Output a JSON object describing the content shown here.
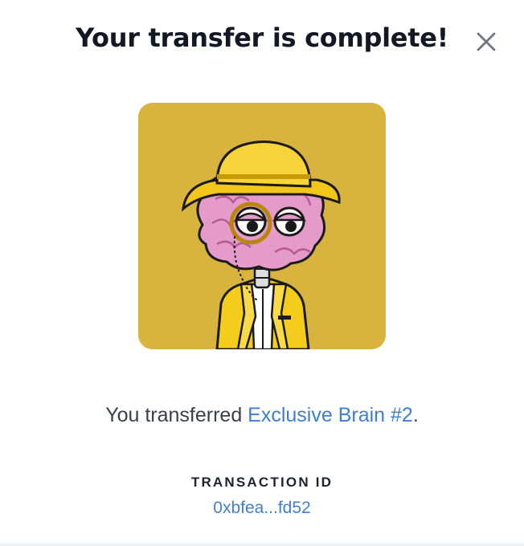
{
  "dialog": {
    "title": "Your transfer is complete!",
    "close_icon": "close-icon",
    "nft_image": "brain-character-nft-image",
    "message_prefix": "You transferred ",
    "nft_name": "Exclusive Brain #2",
    "message_suffix": ".",
    "transaction_label": "TRANSACTION ID",
    "transaction_id": "0xbfea...fd52"
  },
  "colors": {
    "accent_link": "#3d7fd1",
    "title_text": "#121824",
    "art_background": "#d8b43e",
    "brain_pink": "#e49bc9",
    "hat_yellow": "#f2c719"
  }
}
